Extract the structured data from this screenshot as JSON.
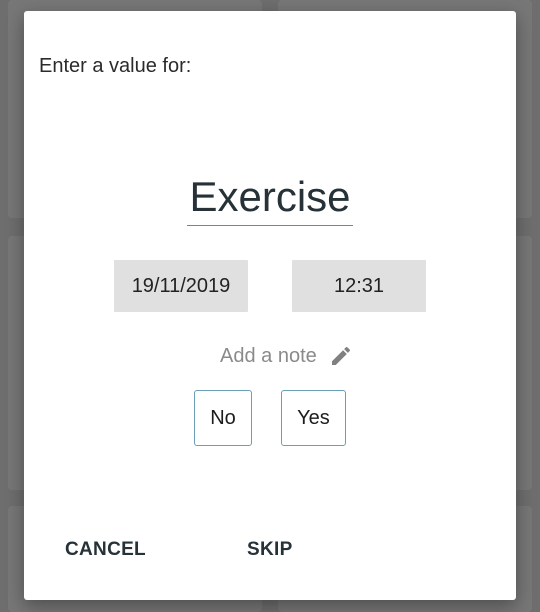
{
  "dialog": {
    "prompt": "Enter a value for:",
    "habit_name": "Exercise",
    "date": "19/11/2019",
    "time": "12:31",
    "note_label": "Add a note",
    "options": {
      "no": "No",
      "yes": "Yes"
    },
    "actions": {
      "cancel": "CANCEL",
      "skip": "SKIP"
    }
  },
  "icons": {
    "note_icon": "pencil-icon"
  },
  "colors": {
    "accent": "#6a9fb5",
    "title_text": "#263238",
    "chip_bg": "#e0e0e0",
    "muted_text": "#8a8a8a",
    "scrim": "#6e6e6e"
  }
}
